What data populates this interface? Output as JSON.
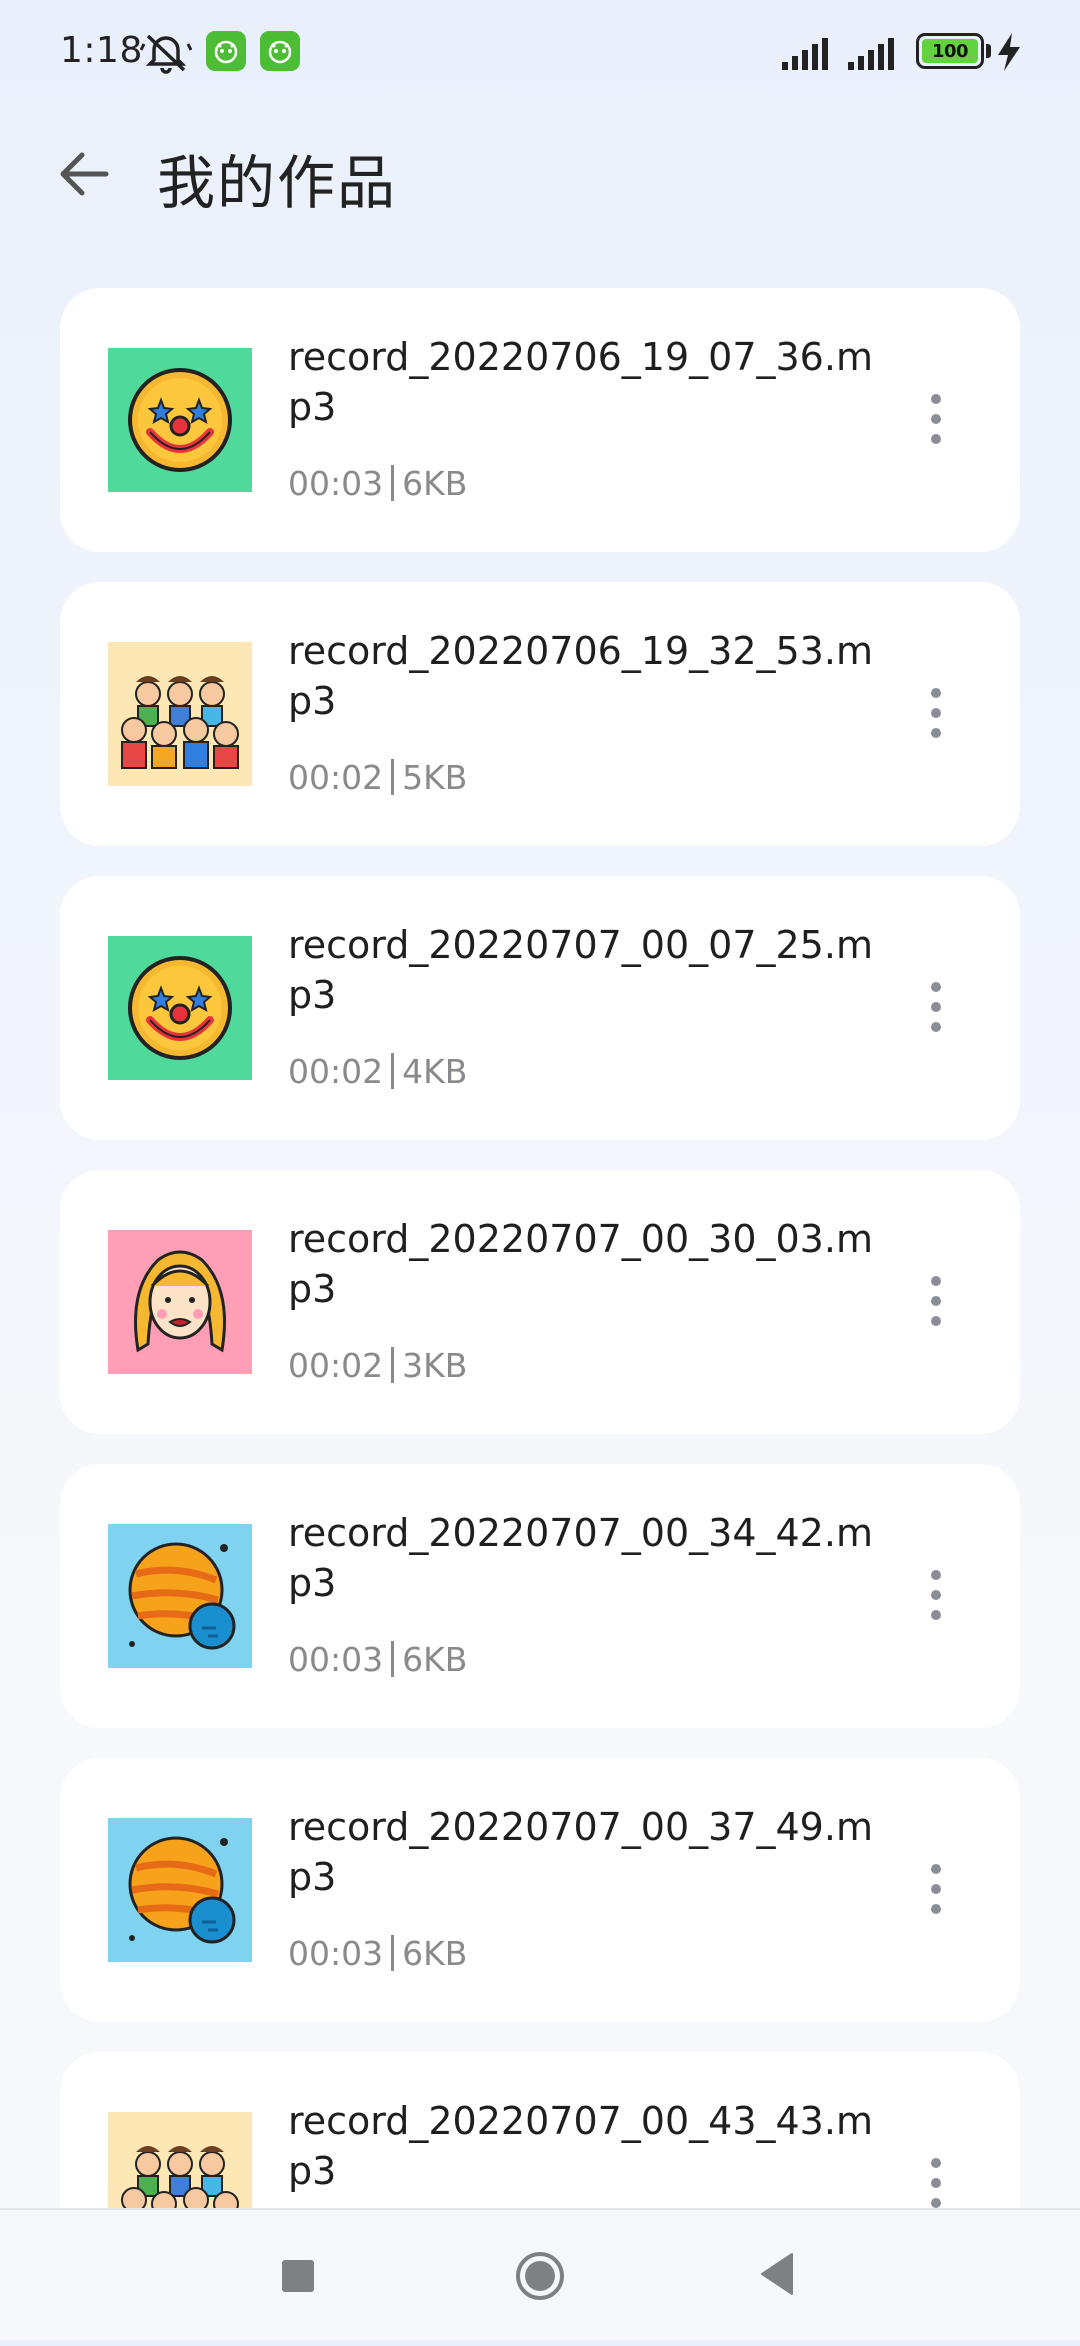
{
  "status_bar": {
    "time": "1:18",
    "battery": "100",
    "icons": [
      "mute-icon",
      "app-badge-icon",
      "app-badge-icon",
      "signal-icon",
      "signal-icon",
      "battery-icon",
      "charging-icon"
    ]
  },
  "header": {
    "title": "我的作品",
    "back_icon": "arrow-left-icon"
  },
  "recordings": [
    {
      "name": "record_20220706_19_07_36.mp3",
      "duration": "00:03",
      "size": "6KB",
      "thumb": "clown-face",
      "thumb_bg": "#4fd99a"
    },
    {
      "name": "record_20220706_19_32_53.mp3",
      "duration": "00:02",
      "size": "5KB",
      "thumb": "kids-group",
      "thumb_bg": "#fde7b5"
    },
    {
      "name": "record_20220707_00_07_25.mp3",
      "duration": "00:02",
      "size": "4KB",
      "thumb": "clown-face",
      "thumb_bg": "#4fd99a"
    },
    {
      "name": "record_20220707_00_30_03.mp3",
      "duration": "00:02",
      "size": "3KB",
      "thumb": "girl-face",
      "thumb_bg": "#ff9eb4"
    },
    {
      "name": "record_20220707_00_34_42.mp3",
      "duration": "00:03",
      "size": "6KB",
      "thumb": "planet",
      "thumb_bg": "#7fd2f0"
    },
    {
      "name": "record_20220707_00_37_49.mp3",
      "duration": "00:03",
      "size": "6KB",
      "thumb": "planet",
      "thumb_bg": "#7fd2f0"
    },
    {
      "name": "record_20220707_00_43_43.mp3",
      "duration": "",
      "size": "",
      "thumb": "kids-group",
      "thumb_bg": "#fde7b5"
    }
  ],
  "nav_bar": {
    "buttons": [
      "recents-square-icon",
      "home-circle-icon",
      "back-triangle-icon"
    ]
  }
}
